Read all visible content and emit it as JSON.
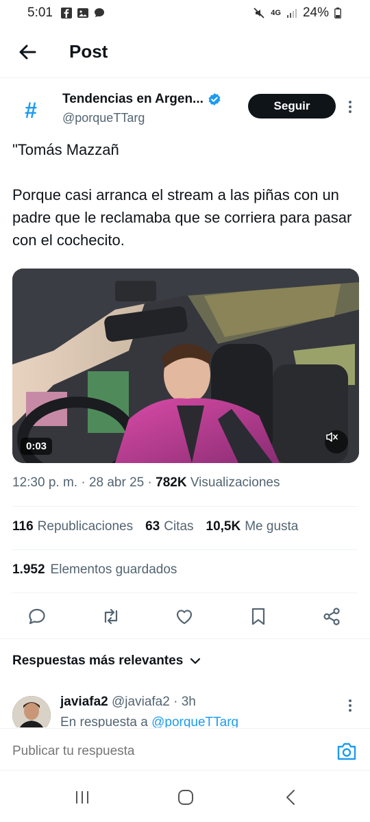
{
  "status_bar": {
    "time": "5:01",
    "network": "4G",
    "battery": "24%"
  },
  "header": {
    "title": "Post"
  },
  "author": {
    "name": "Tendencias en Argen...",
    "handle": "@porqueTTarg",
    "verified": true,
    "follow_label": "Seguir",
    "avatar_symbol": "#"
  },
  "tweet": {
    "text": "\"Tomás Mazzañ\n\nPorque casi arranca el stream a las piñas con un padre que le reclamaba que se corriera para pasar con el cochecito.",
    "video_duration": "0:03",
    "time": "12:30 p. m.",
    "date": "28 abr 25",
    "views_count": "782K",
    "views_label": "Visualizaciones"
  },
  "stats": {
    "reposts_count": "116",
    "reposts_label": "Republicaciones",
    "quotes_count": "63",
    "quotes_label": "Citas",
    "likes_count": "10,5K",
    "likes_label": "Me gusta",
    "bookmarks_count": "1.952",
    "bookmarks_label": "Elementos guardados"
  },
  "replies": {
    "filter_label": "Respuestas más relevantes",
    "items": [
      {
        "name": "javiafa2",
        "handle": "@javiafa2",
        "time": "3h",
        "reply_to_prefix": "En respuesta a",
        "reply_to_handle": "@porqueTTarg"
      }
    ]
  },
  "compose": {
    "placeholder": "Publicar tu respuesta"
  },
  "colors": {
    "accent": "#1d9bf0",
    "text_primary": "#0f1419",
    "text_secondary": "#536471",
    "button_dark": "#0f1419"
  }
}
